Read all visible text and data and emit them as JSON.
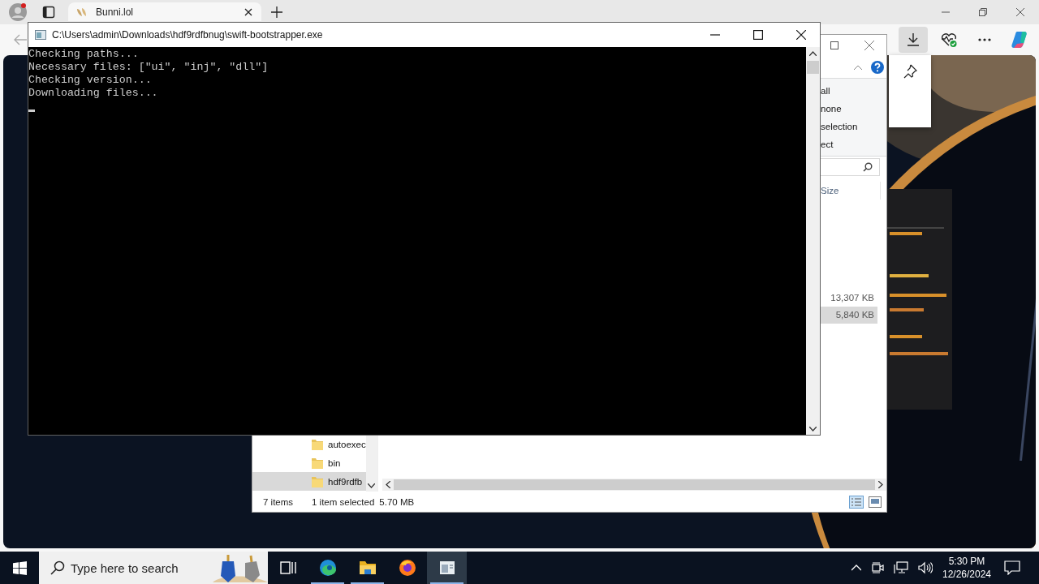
{
  "browser": {
    "tabs": [
      {
        "title": "Bunni.lol",
        "selected": true
      }
    ]
  },
  "console": {
    "title": "C:\\Users\\admin\\Downloads\\hdf9rdfbnug\\swift-bootstrapper.exe",
    "lines": [
      "Checking paths...",
      "Necessary files: [\"ui\", \"inj\", \"dll\"]",
      "Checking version...",
      "Downloading files..."
    ],
    "cursor": true
  },
  "explorer": {
    "ribbon_commands": [
      "all",
      "none",
      "selection",
      "ect"
    ],
    "columns": [
      "Size"
    ],
    "files": [
      {
        "size": "13,307 KB",
        "selected": false
      },
      {
        "size": "5,840 KB",
        "selected": true
      }
    ],
    "folders": [
      {
        "name": "autoexec",
        "selected": false
      },
      {
        "name": "bin",
        "selected": false
      },
      {
        "name": "hdf9rdfb",
        "selected": true
      }
    ],
    "status": {
      "items": "7 items",
      "selection": "1 item selected",
      "size": "5.70 MB"
    }
  },
  "taskbar": {
    "search": {
      "placeholder": "Type here to search"
    },
    "apps": [
      {
        "kind": "task-view",
        "running": false,
        "selected": false
      },
      {
        "kind": "edge",
        "running": true,
        "selected": false
      },
      {
        "kind": "explorer",
        "running": true,
        "selected": false
      },
      {
        "kind": "firefox",
        "running": false,
        "selected": false
      },
      {
        "kind": "console",
        "running": true,
        "selected": true
      }
    ],
    "time": "5:30 PM",
    "date": "12/26/2024"
  }
}
